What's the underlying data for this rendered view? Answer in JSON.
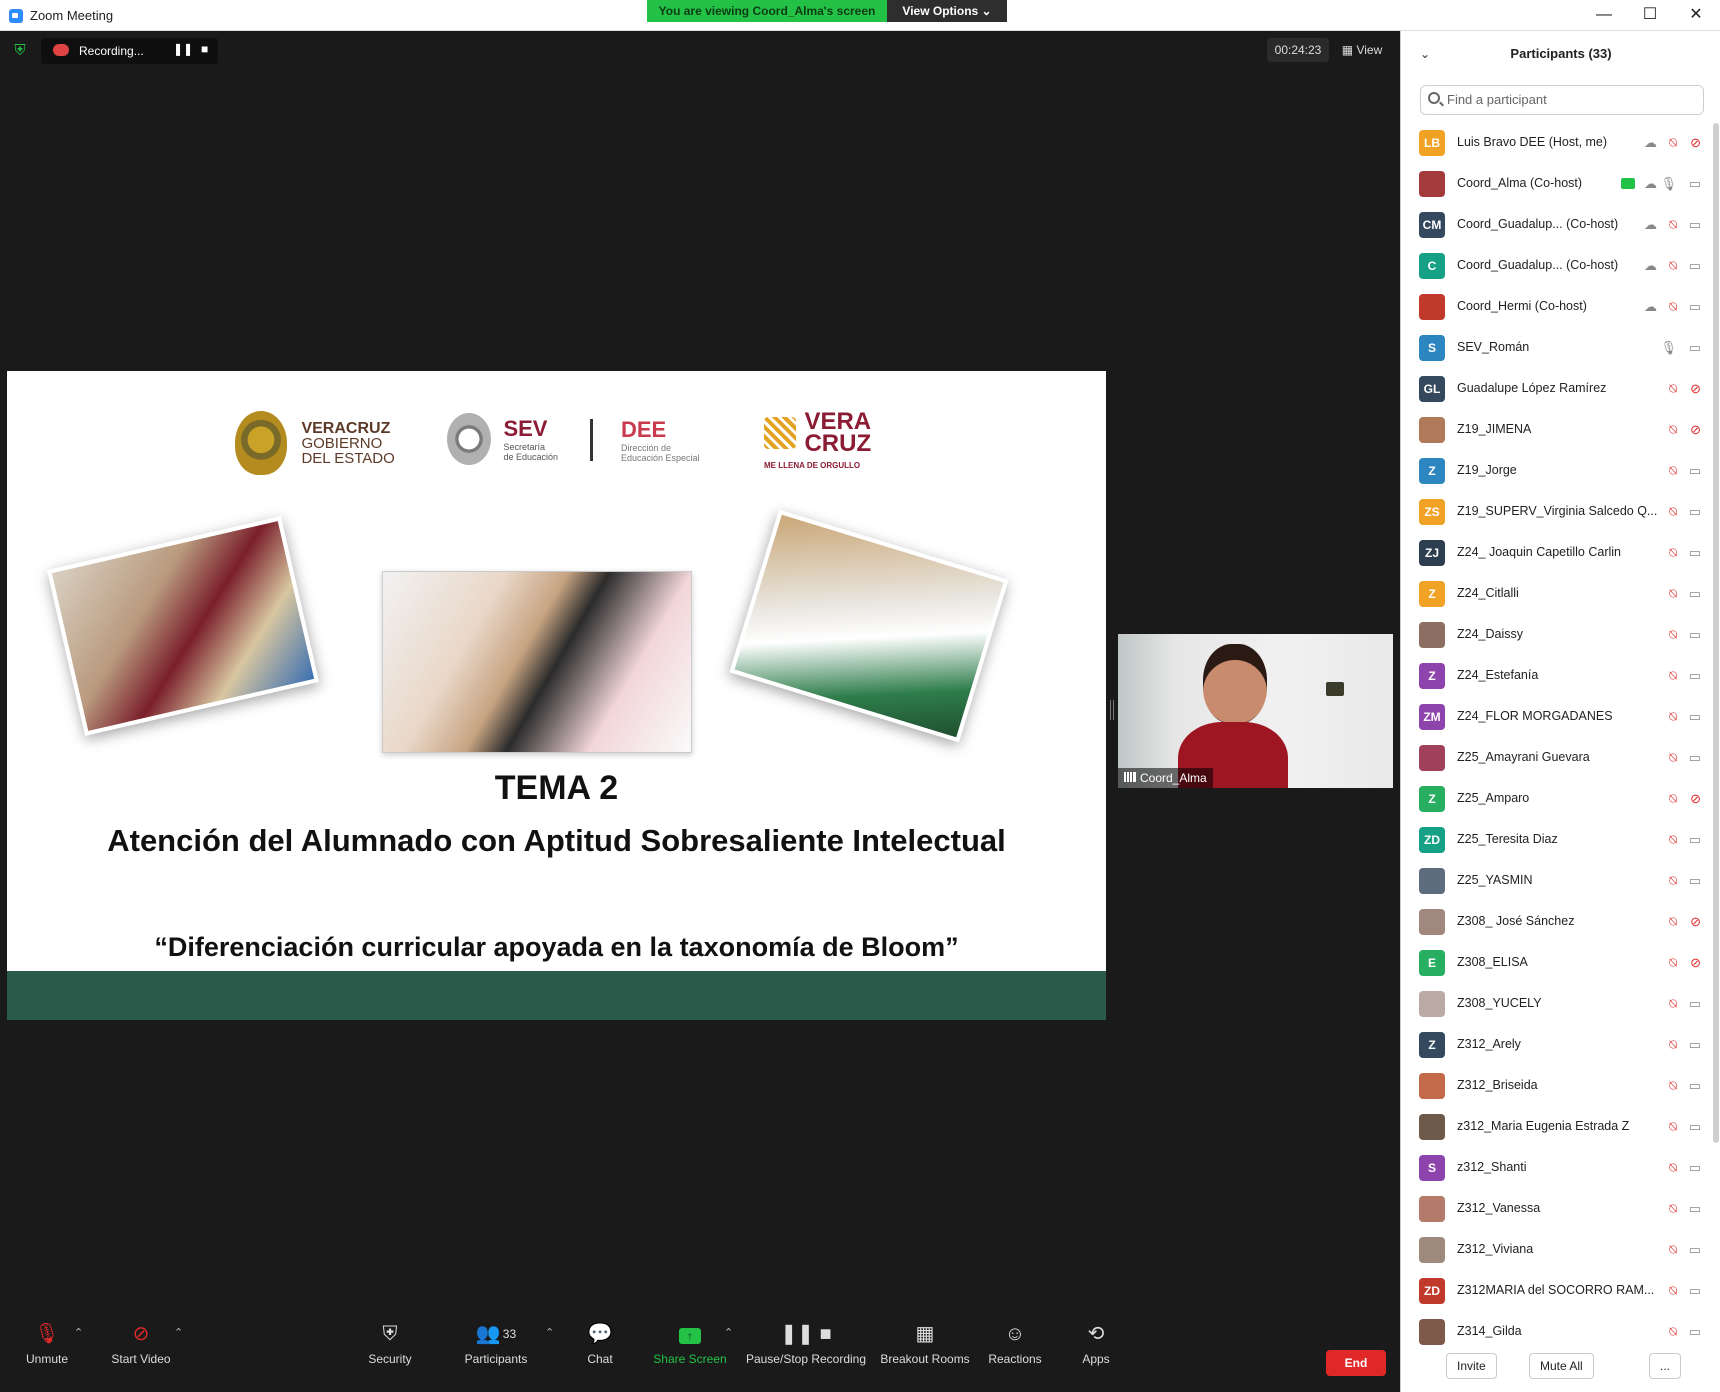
{
  "window": {
    "app_title": "Zoom Meeting",
    "viewing_banner": "You are viewing Coord_Alma's screen",
    "view_options": "View Options ⌄",
    "controls": {
      "minimize": "—",
      "maximize": "☐",
      "close": "✕"
    }
  },
  "meeting": {
    "recording_label": "Recording...",
    "timer": "00:24:23",
    "view_label": "View"
  },
  "slide": {
    "logo_vgob_line1": "VERACRUZ",
    "logo_vgob_line2": "GOBIERNO",
    "logo_vgob_line3": "DEL ESTADO",
    "logo_sev": "SEV",
    "logo_sev_sub1": "Secretaría",
    "logo_sev_sub2": "de Educación",
    "logo_dee": "DEE",
    "logo_dee_sub1": "Dirección de",
    "logo_dee_sub2": "Educación Especial",
    "logo_vera1": "VERA",
    "logo_vera2": "CRUZ",
    "logo_vera_tag": "ME LLENA DE ORGULLO",
    "tema": "TEMA 2",
    "headline": "Atención del Alumnado con Aptitud Sobresaliente Intelectual",
    "quote": "“Diferenciación curricular apoyada en la taxonomía de Bloom”"
  },
  "thumbnail": {
    "name": "Coord_Alma"
  },
  "toolbar": {
    "unmute": "Unmute",
    "start_video": "Start Video",
    "security": "Security",
    "participants": "Participants",
    "participants_count": "33",
    "chat": "Chat",
    "share_screen": "Share Screen",
    "pause_stop": "Pause/Stop Recording",
    "breakout": "Breakout Rooms",
    "reactions": "Reactions",
    "apps": "Apps",
    "end": "End"
  },
  "panel": {
    "title": "Participants (33)",
    "search_placeholder": "Find a participant",
    "invite": "Invite",
    "mute_all": "Mute All",
    "more": "..."
  },
  "participants": [
    {
      "name": "Luis Bravo DEE (Host, me)",
      "initials": "LB",
      "color": "#f0a225",
      "cloud": true,
      "mic": "muted",
      "cam": "off"
    },
    {
      "name": "Coord_Alma (Co-host)",
      "initials": "",
      "color": "#a33b3b",
      "cloud": true,
      "share": true,
      "mic": "on",
      "cam": "on"
    },
    {
      "name": "Coord_Guadalup...  (Co-host)",
      "initials": "CM",
      "color": "#34495e",
      "cloud": true,
      "mic": "muted",
      "cam": "on"
    },
    {
      "name": "Coord_Guadalup...  (Co-host)",
      "initials": "C",
      "color": "#16a085",
      "cloud": true,
      "mic": "muted",
      "cam": "on"
    },
    {
      "name": "Coord_Hermi (Co-host)",
      "initials": "",
      "color": "#c0392b",
      "cloud": true,
      "mic": "muted",
      "cam": "on"
    },
    {
      "name": "SEV_Román",
      "initials": "S",
      "color": "#2e86c1",
      "mic": "on",
      "cam": "on"
    },
    {
      "name": "Guadalupe López Ramírez",
      "initials": "GL",
      "color": "#34495e",
      "mic": "muted",
      "cam": "off"
    },
    {
      "name": "Z19_JIMENA",
      "initials": "",
      "color": "#b07a5a",
      "mic": "muted",
      "cam": "off"
    },
    {
      "name": "Z19_Jorge",
      "initials": "Z",
      "color": "#2e86c1",
      "mic": "muted",
      "cam": "on"
    },
    {
      "name": "Z19_SUPERV_Virginia Salcedo Q...",
      "initials": "ZS",
      "color": "#f0a225",
      "mic": "muted",
      "cam": "on"
    },
    {
      "name": "Z24_ Joaquin Capetillo Carlin",
      "initials": "ZJ",
      "color": "#2c3e50",
      "mic": "muted",
      "cam": "on"
    },
    {
      "name": "Z24_Citlalli",
      "initials": "Z",
      "color": "#f0a225",
      "mic": "muted",
      "cam": "on"
    },
    {
      "name": "Z24_Daissy",
      "initials": "",
      "color": "#8d6e63",
      "mic": "muted",
      "cam": "on"
    },
    {
      "name": "Z24_Estefanía",
      "initials": "Z",
      "color": "#8e44ad",
      "mic": "muted",
      "cam": "on"
    },
    {
      "name": "Z24_FLOR MORGADANES",
      "initials": "ZM",
      "color": "#8e44ad",
      "mic": "muted",
      "cam": "on"
    },
    {
      "name": "Z25_Amayrani Guevara",
      "initials": "",
      "color": "#a0405a",
      "mic": "muted",
      "cam": "on"
    },
    {
      "name": "Z25_Amparo",
      "initials": "Z",
      "color": "#27ae60",
      "mic": "muted",
      "cam": "off"
    },
    {
      "name": "Z25_Teresita Diaz",
      "initials": "ZD",
      "color": "#16a085",
      "mic": "muted",
      "cam": "on"
    },
    {
      "name": "Z25_YASMIN",
      "initials": "",
      "color": "#5d6d7e",
      "mic": "muted",
      "cam": "on"
    },
    {
      "name": "Z308_ José Sánchez",
      "initials": "",
      "color": "#a1887f",
      "mic": "muted",
      "cam": "off"
    },
    {
      "name": "Z308_ELISA",
      "initials": "E",
      "color": "#27ae60",
      "mic": "muted",
      "cam": "off"
    },
    {
      "name": "Z308_YUCELY",
      "initials": "",
      "color": "#bcaaa4",
      "mic": "muted",
      "cam": "on"
    },
    {
      "name": "Z312_Arely",
      "initials": "Z",
      "color": "#34495e",
      "mic": "muted",
      "cam": "on"
    },
    {
      "name": "Z312_Briseida",
      "initials": "",
      "color": "#c46a4a",
      "mic": "muted",
      "cam": "on"
    },
    {
      "name": "z312_Maria Eugenia Estrada Z",
      "initials": "",
      "color": "#6d5a4a",
      "mic": "muted",
      "cam": "on"
    },
    {
      "name": "z312_Shanti",
      "initials": "S",
      "color": "#8e44ad",
      "mic": "muted",
      "cam": "on"
    },
    {
      "name": "Z312_Vanessa",
      "initials": "",
      "color": "#b57b6a",
      "mic": "muted",
      "cam": "on"
    },
    {
      "name": "Z312_Viviana",
      "initials": "",
      "color": "#9e8b7d",
      "mic": "muted",
      "cam": "on"
    },
    {
      "name": "Z312MARIA del SOCORRO RAM...",
      "initials": "ZD",
      "color": "#c0392b",
      "mic": "muted",
      "cam": "on"
    },
    {
      "name": "Z314_Gilda",
      "initials": "",
      "color": "#7d5a4a",
      "mic": "muted",
      "cam": "on"
    }
  ]
}
